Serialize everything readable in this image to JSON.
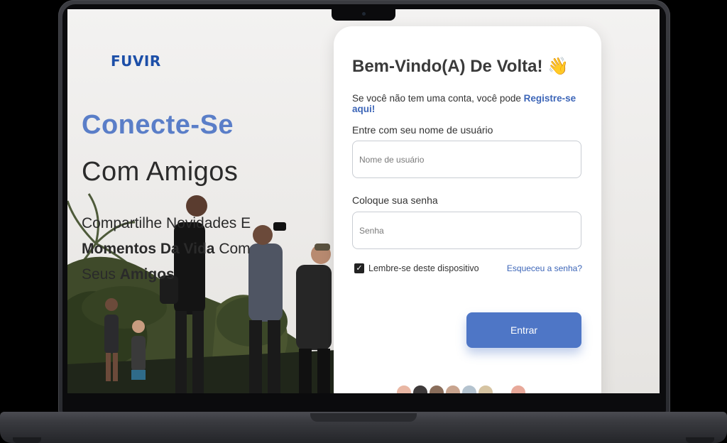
{
  "brand": "FUVIR",
  "hero": {
    "line1": "Conecte-Se",
    "line2": "Com Amigos",
    "desc_a": "Compartilhe Novidades E",
    "desc_b_bold": "Momentos Da Vida",
    "desc_b": " Com",
    "desc_c": "Seus ",
    "desc_c_bold": "Amigos"
  },
  "card": {
    "title": "Bem-Vindo(A) De Volta! 👋",
    "subtitle": "Se você não tem uma conta, você pode ",
    "register_link": "Registre-se aqui!",
    "username_label": "Entre com seu nome de usuário",
    "username_placeholder": "Nome de usuário",
    "password_label": "Coloque sua senha",
    "password_placeholder": "Senha",
    "remember_label": "Lembre-se deste dispositivo",
    "forgot_link": "Esqueceu a senha?",
    "submit_label": "Entrar"
  },
  "colors": {
    "brand": "#1d4fa8",
    "accent": "#4e76c6",
    "hero_accent": "#5a7ec8"
  },
  "avatars": [
    "#e9b7a4",
    "#3e3a3a",
    "#8a6e5b",
    "#c8a48e",
    "#b4c3cf",
    "#d6c4a2",
    "#ffffff",
    "#e8a99a"
  ]
}
